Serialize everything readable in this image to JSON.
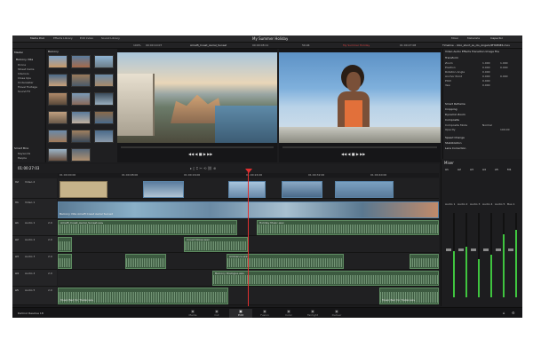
{
  "top_tabs": [
    "Media Pool",
    "Effects Library",
    "Edit Index",
    "Sound Library"
  ],
  "right_tabs": [
    "Mixer",
    "Metadata",
    "Inspector"
  ],
  "project_title": "My Summer Holiday",
  "source": {
    "clip": "Amalfi_Coast_Aerial_Sunset",
    "tc_in": "00:00:10:07",
    "tc_out": "00:00:08:11",
    "zoom": "100%",
    "fps_label": "59.94"
  },
  "program": {
    "timeline": "My Summer Holiday",
    "tc": "01:00:27:08"
  },
  "inspector": {
    "header": "Timeline - dolo_stunt_ss_ols_Angelo/PHSENE4.mov",
    "tabs": [
      "Video",
      "Audio",
      "Effects",
      "Transition",
      "Image",
      "File"
    ],
    "sections": [
      "Transform",
      "Smart Reframe",
      "Cropping",
      "Dynamic Zoom",
      "Composite",
      "Speed Change",
      "Stabilization",
      "Lens Correction"
    ],
    "rows": [
      {
        "label": "Zoom",
        "v1": "1.000",
        "v2": "1.000"
      },
      {
        "label": "Position",
        "v1": "0.000",
        "v2": "0.000"
      },
      {
        "label": "Rotation Angle",
        "v1": "0.000",
        "v2": ""
      },
      {
        "label": "Anchor Point",
        "v1": "0.000",
        "v2": "0.000"
      },
      {
        "label": "Pitch",
        "v1": "0.000",
        "v2": ""
      },
      {
        "label": "Yaw",
        "v1": "0.000",
        "v2": ""
      }
    ],
    "composite_mode_label": "Composite Mode",
    "composite_mode": "Normal",
    "opacity_label": "Opacity",
    "opacity": "100.00"
  },
  "media_pool": {
    "bins": [
      "Master",
      "Balcony Villa",
      "Drone",
      "Street Cams",
      "Interiors",
      "Close Ups",
      "Underwater",
      "Travel Footage",
      "Sound FX"
    ],
    "smart_bins_label": "Smart Bins",
    "smart_bins": [
      "Keywords",
      "People"
    ],
    "header": "Balcony"
  },
  "timeline": {
    "timecode": "01:00:27:03",
    "ruler": [
      "01:00:00:00",
      "01:00:08:00",
      "01:00:16:00",
      "01:00:24:00",
      "01:00:32:00",
      "01:00:40:00",
      "01:00:48:00"
    ],
    "tracks": [
      {
        "id": "V2",
        "name": "Video 2",
        "type": "video"
      },
      {
        "id": "V1",
        "name": "Video 1",
        "type": "video"
      },
      {
        "id": "A1",
        "name": "Audio 1",
        "type": "audio",
        "level": "2.0"
      },
      {
        "id": "A2",
        "name": "Audio 2",
        "type": "audio",
        "level": "2.0"
      },
      {
        "id": "A3",
        "name": "Audio 3",
        "type": "audio",
        "level": "2.0"
      },
      {
        "id": "A4",
        "name": "Audio 4",
        "type": "audio",
        "level": "2.0"
      },
      {
        "id": "A5",
        "name": "Audio 5",
        "type": "audio",
        "level": "2.0"
      }
    ],
    "clip_labels": {
      "v1_main": "Balcony Villa Amalfi Coast Aerial Sunset",
      "a1_1": "Amalfi_Coast_Aerial_Sunset.wav",
      "a1_2": "Holiday Music.wav",
      "a2_1": "Crowd Noise.wav",
      "a3_1": "Ambience.wav",
      "a4_1": "Balcony Dialogue.wav",
      "a5_1": "Music Bed for Trailer.wav",
      "a5_2": "Music Bed for Trailer.wav"
    }
  },
  "mixer": {
    "title": "Mixer",
    "channels": [
      "A1",
      "A2",
      "A3",
      "A4",
      "A5",
      "M1"
    ],
    "labels": [
      "Audio 1",
      "Audio 2",
      "Audio 3",
      "Audio 4",
      "Audio 5",
      "Bus 1"
    ],
    "meter_levels": [
      0.55,
      0.6,
      0.45,
      0.5,
      0.75,
      0.8
    ]
  },
  "app_name": "DaVinci Resolve 18",
  "pages": [
    "Media",
    "Cut",
    "Edit",
    "Fusion",
    "Color",
    "Fairlight",
    "Deliver"
  ],
  "active_page": "Edit"
}
